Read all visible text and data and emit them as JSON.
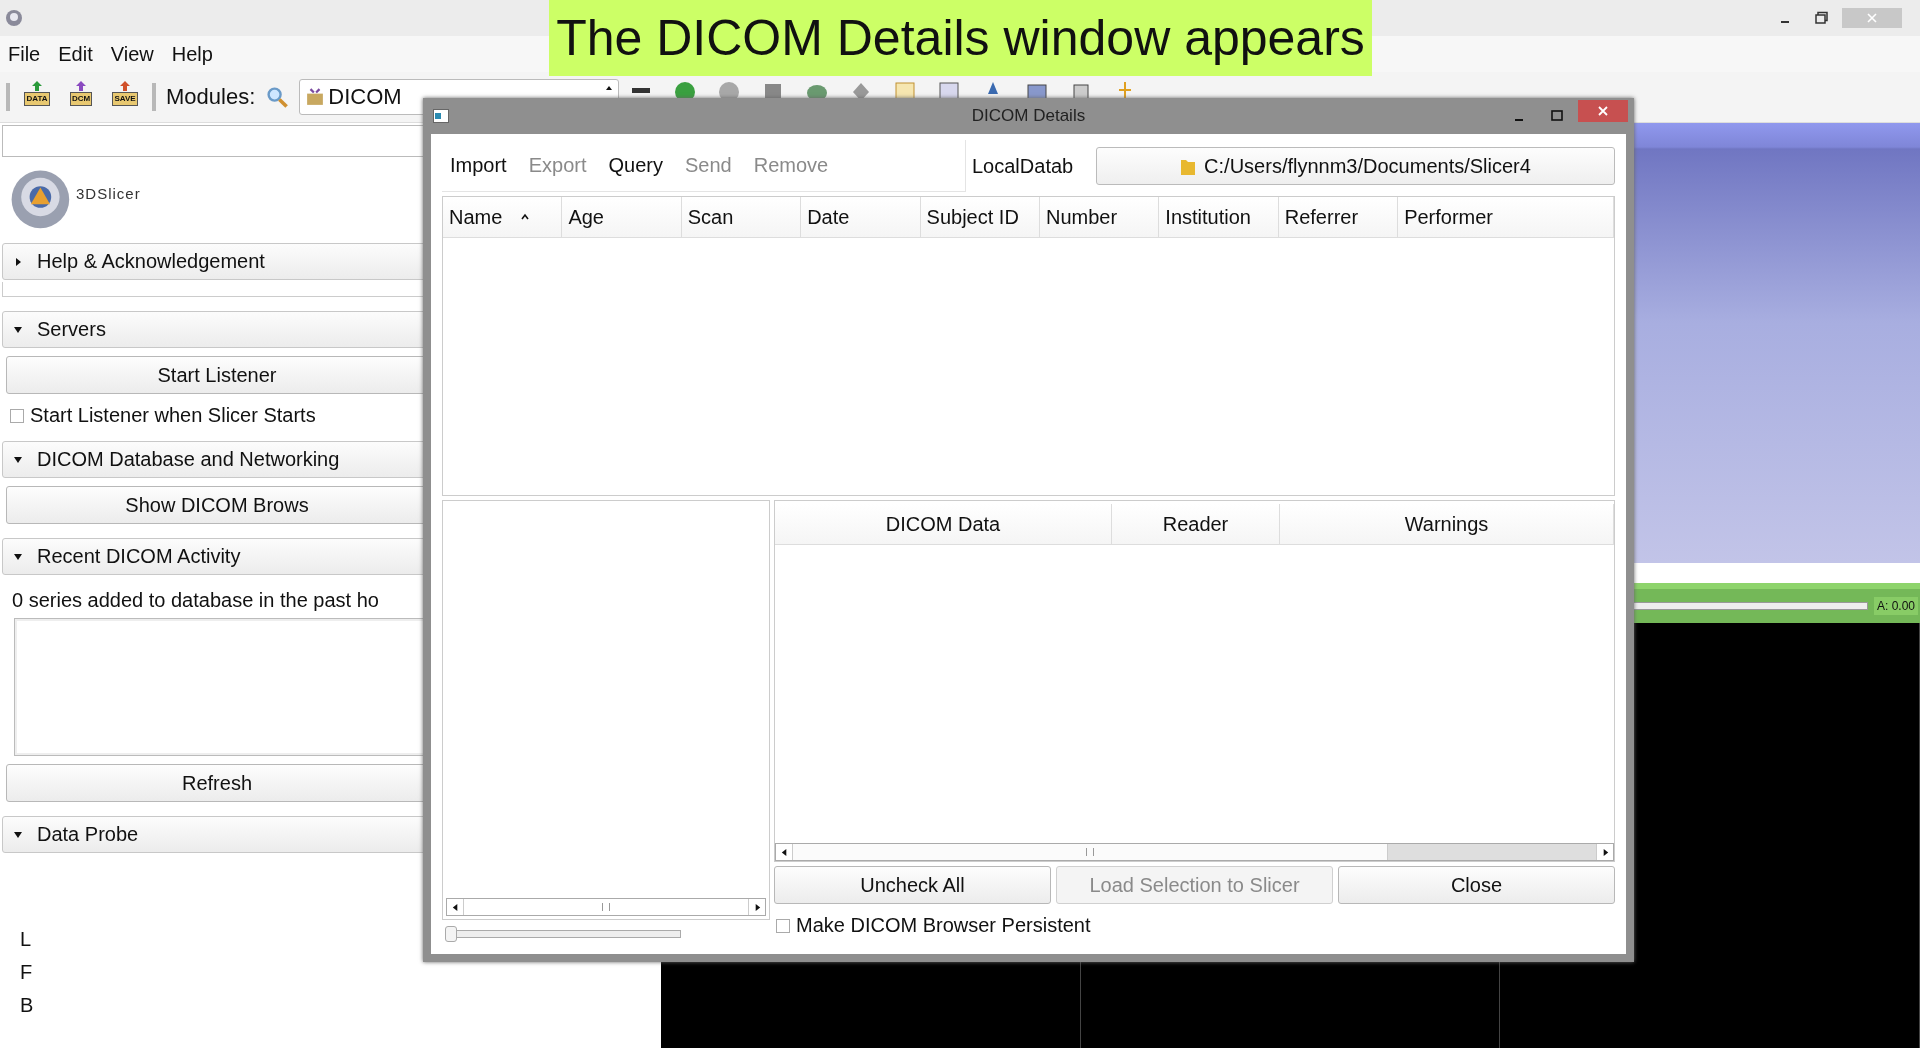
{
  "caption": "The DICOM Details window appears",
  "menu": [
    "File",
    "Edit",
    "View",
    "Help"
  ],
  "toolbar": {
    "buttons": [
      "DATA",
      "DCM",
      "SAVE"
    ],
    "modules_label": "Modules:",
    "module": "DICOM"
  },
  "left_panel": {
    "logo_text": "3DSlicer",
    "items": [
      {
        "kind": "header",
        "label": "Help & Acknowledgement",
        "expanded": false
      },
      {
        "kind": "header",
        "label": "Servers",
        "expanded": true
      },
      {
        "kind": "button",
        "label": "Start Listener"
      },
      {
        "kind": "checkbox",
        "label": "Start Listener when Slicer Starts",
        "checked": false
      },
      {
        "kind": "header",
        "label": "DICOM Database and Networking",
        "expanded": true
      },
      {
        "kind": "button",
        "label": "Show DICOM Brows"
      },
      {
        "kind": "header",
        "label": "Recent DICOM Activity",
        "expanded": true
      },
      {
        "kind": "text",
        "label": "0 series added to database in the past ho"
      },
      {
        "kind": "textarea"
      },
      {
        "kind": "button",
        "label": "Refresh"
      },
      {
        "kind": "header",
        "label": "Data Probe",
        "expanded": true
      }
    ]
  },
  "orientation_labels": [
    "L",
    "F",
    "B"
  ],
  "viewer": {
    "slider": {
      "level": 1
    },
    "slider_reading": "A: 0.00"
  },
  "dialog": {
    "title": "DICOM Details",
    "actions": [
      {
        "label": "Import",
        "disabled": false
      },
      {
        "label": "Export",
        "disabled": true
      },
      {
        "label": "Query",
        "disabled": false
      },
      {
        "label": "Send",
        "disabled": true
      },
      {
        "label": "Remove",
        "disabled": true
      }
    ],
    "database_label": "LocalDatab",
    "database_path": "C:/Users/flynnm3/Documents/Slicer4",
    "columns": [
      {
        "label": "Name",
        "sorted": true
      },
      {
        "label": "Age",
        "sorted": false
      },
      {
        "label": "Scan",
        "sorted": false
      },
      {
        "label": "Date",
        "sorted": false
      },
      {
        "label": "Subject ID",
        "sorted": false
      },
      {
        "label": "Number",
        "sorted": false
      },
      {
        "label": "Institution",
        "sorted": false
      },
      {
        "label": "Referrer",
        "sorted": false
      },
      {
        "label": "Performer",
        "sorted": false
      }
    ],
    "zoom_slider": {
      "level": 0
    },
    "loadable_columns": [
      "DICOM Data",
      "Reader",
      "Warnings"
    ],
    "buttons": [
      {
        "label": "Uncheck All",
        "disabled": false
      },
      {
        "label": "Load Selection to Slicer",
        "disabled": true
      },
      {
        "label": "Close",
        "disabled": false
      }
    ],
    "persistent": {
      "label": "Make DICOM Browser Persistent",
      "checked": false
    }
  }
}
